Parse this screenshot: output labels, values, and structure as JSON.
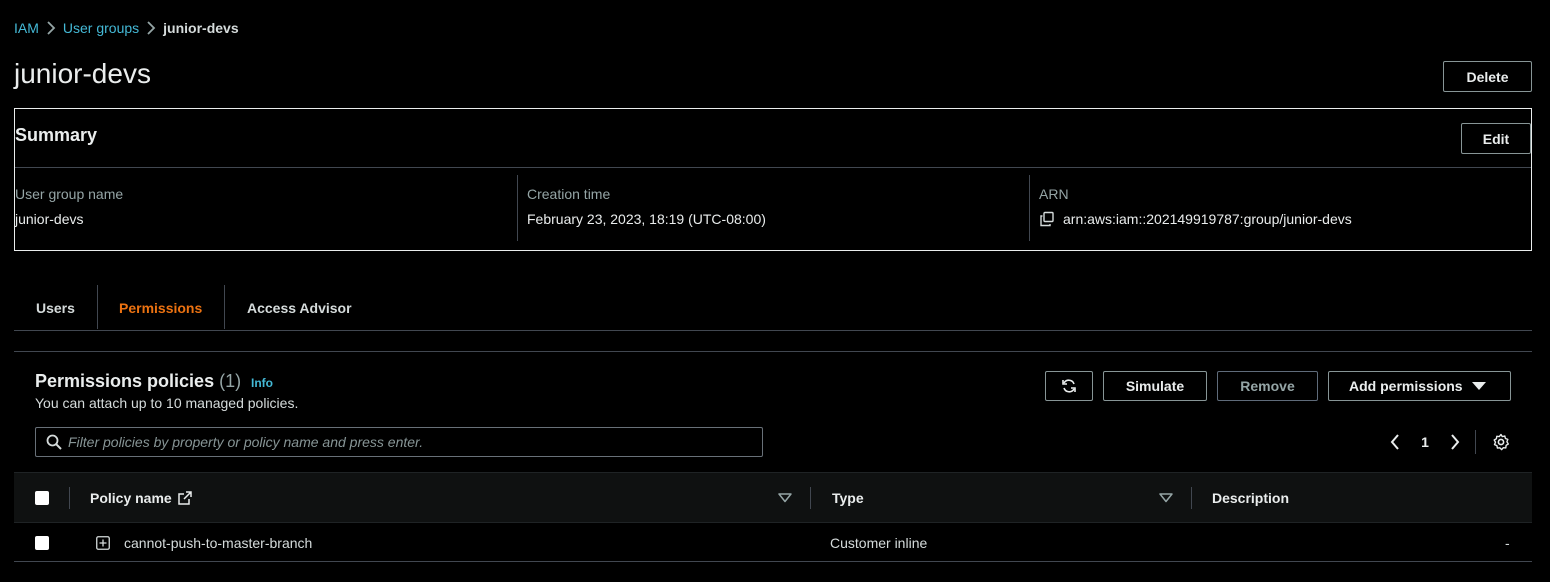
{
  "breadcrumb": {
    "items": [
      "IAM",
      "User groups",
      "junior-devs"
    ]
  },
  "page": {
    "title": "junior-devs",
    "delete_label": "Delete"
  },
  "summary": {
    "title": "Summary",
    "edit_label": "Edit",
    "fields": [
      {
        "label": "User group name",
        "value": "junior-devs"
      },
      {
        "label": "Creation time",
        "value": "February 23, 2023, 18:19 (UTC-08:00)"
      },
      {
        "label": "ARN",
        "value": "arn:aws:iam::202149919787:group/junior-devs",
        "icon": "copy-icon"
      }
    ]
  },
  "tabs": [
    {
      "label": "Users",
      "active": false
    },
    {
      "label": "Permissions",
      "active": true
    },
    {
      "label": "Access Advisor",
      "active": false
    }
  ],
  "policies": {
    "title": "Permissions policies",
    "count": "(1)",
    "info_label": "Info",
    "subtitle": "You can attach up to 10 managed policies.",
    "refresh_icon": "refresh-icon",
    "simulate_label": "Simulate",
    "remove_label": "Remove",
    "add_label": "Add permissions",
    "filter_placeholder": "Filter policies by property or policy name and press enter.",
    "page_number": "1",
    "columns": [
      "Policy name",
      "Type",
      "Description"
    ],
    "rows": [
      {
        "name": "cannot-push-to-master-branch",
        "type": "Customer inline",
        "description": "-"
      }
    ]
  },
  "colors": {
    "accent": "#ec7211",
    "link": "#44b9d6",
    "background": "#000000"
  }
}
